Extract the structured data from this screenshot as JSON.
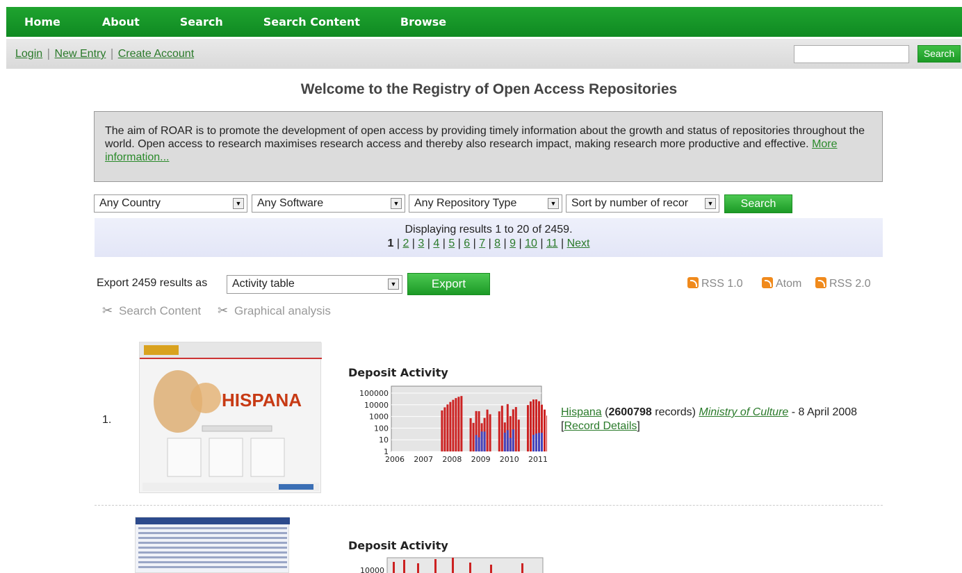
{
  "nav": {
    "items": [
      "Home",
      "About",
      "Search",
      "Search Content",
      "Browse"
    ]
  },
  "subnav": {
    "links": [
      "Login",
      "New Entry",
      "Create Account"
    ],
    "search_placeholder": "",
    "search_button": "Search"
  },
  "page_title": "Welcome to the Registry of Open Access Repositories",
  "intro": {
    "text": "The aim of ROAR is to promote the development of open access by providing timely information about the growth and status of repositories throughout the world. Open access to research maximises research access and thereby also research impact, making research more productive and effective.",
    "link": "More information..."
  },
  "filters": {
    "country": "Any Country",
    "software": "Any Software",
    "type": "Any Repository Type",
    "sort": "Sort by number of recor",
    "search_button": "Search"
  },
  "pager": {
    "status": "Displaying results 1 to 20 of 2459.",
    "current": "1",
    "pages": [
      "2",
      "3",
      "4",
      "5",
      "6",
      "7",
      "8",
      "9",
      "10",
      "11"
    ],
    "next": "Next"
  },
  "export": {
    "label": "Export 2459 results as",
    "format": "Activity table",
    "button": "Export"
  },
  "feeds": [
    "RSS 1.0",
    "Atom",
    "RSS 2.0"
  ],
  "tools": [
    "Search Content",
    "Graphical analysis"
  ],
  "results": [
    {
      "index": "1.",
      "chart_title": "Deposit Activity",
      "name": "Hispana",
      "records": "2600798",
      "records_suffix": "records)",
      "org": "Ministry of Culture",
      "date": "- 8 April 2008",
      "details": "Record Details",
      "thumb_text": "HISPANA"
    },
    {
      "chart_title": "Deposit Activity"
    }
  ],
  "chart_data": {
    "type": "bar",
    "title": "",
    "xlabel": "",
    "ylabel": "",
    "x_ticks": [
      "2006",
      "2007",
      "2008",
      "2009",
      "2010",
      "2011"
    ],
    "y_ticks": [
      "1",
      "10",
      "100",
      "1000",
      "10000",
      "100000"
    ],
    "y_scale": "log",
    "series": [
      {
        "values": [
          0,
          0,
          60000,
          4000,
          12000,
          30000
        ]
      },
      {
        "values": [
          0,
          0,
          0,
          60,
          80,
          40
        ]
      }
    ],
    "colors": [
      "#cc2222",
      "#4444bb"
    ]
  }
}
